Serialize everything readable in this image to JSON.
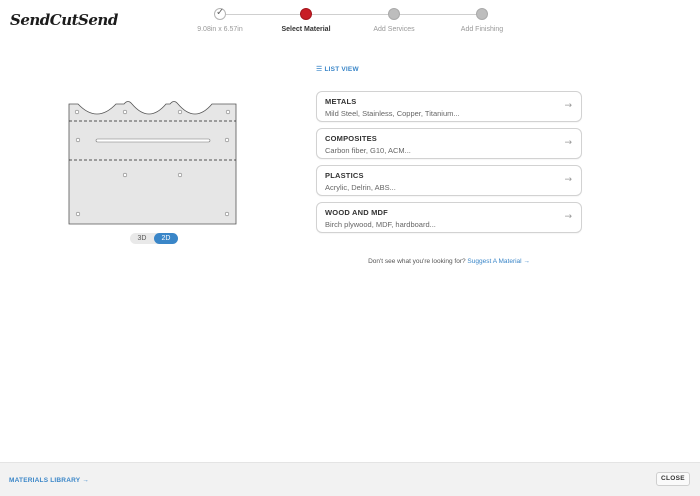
{
  "header": {
    "logo_text": "SendCutSend",
    "steps": [
      {
        "label": "9.08in x 6.57in",
        "state": "done"
      },
      {
        "label": "Select Material",
        "state": "active"
      },
      {
        "label": "Add Services",
        "state": "pending"
      },
      {
        "label": "Add Finishing",
        "state": "pending"
      }
    ]
  },
  "main": {
    "list_view_label": "LIST VIEW",
    "view_toggle": {
      "option_3d": "3D",
      "option_2d": "2D",
      "selected": "2D"
    },
    "materials": [
      {
        "title": "METALS",
        "subtitle": "Mild Steel, Stainless, Copper, Titanium..."
      },
      {
        "title": "COMPOSITES",
        "subtitle": "Carbon fiber, G10, ACM..."
      },
      {
        "title": "PLASTICS",
        "subtitle": "Acrylic, Delrin, ABS..."
      },
      {
        "title": "WOOD AND MDF",
        "subtitle": "Birch plywood, MDF, hardboard..."
      }
    ],
    "suggest_text": "Don't see what you're looking for?",
    "suggest_link": "Suggest A Material"
  },
  "footer": {
    "library_link": "MATERIALS LIBRARY",
    "close_label": "CLOSE"
  },
  "colors": {
    "accent": "#3a86c8",
    "active_step": "#c81d25"
  }
}
